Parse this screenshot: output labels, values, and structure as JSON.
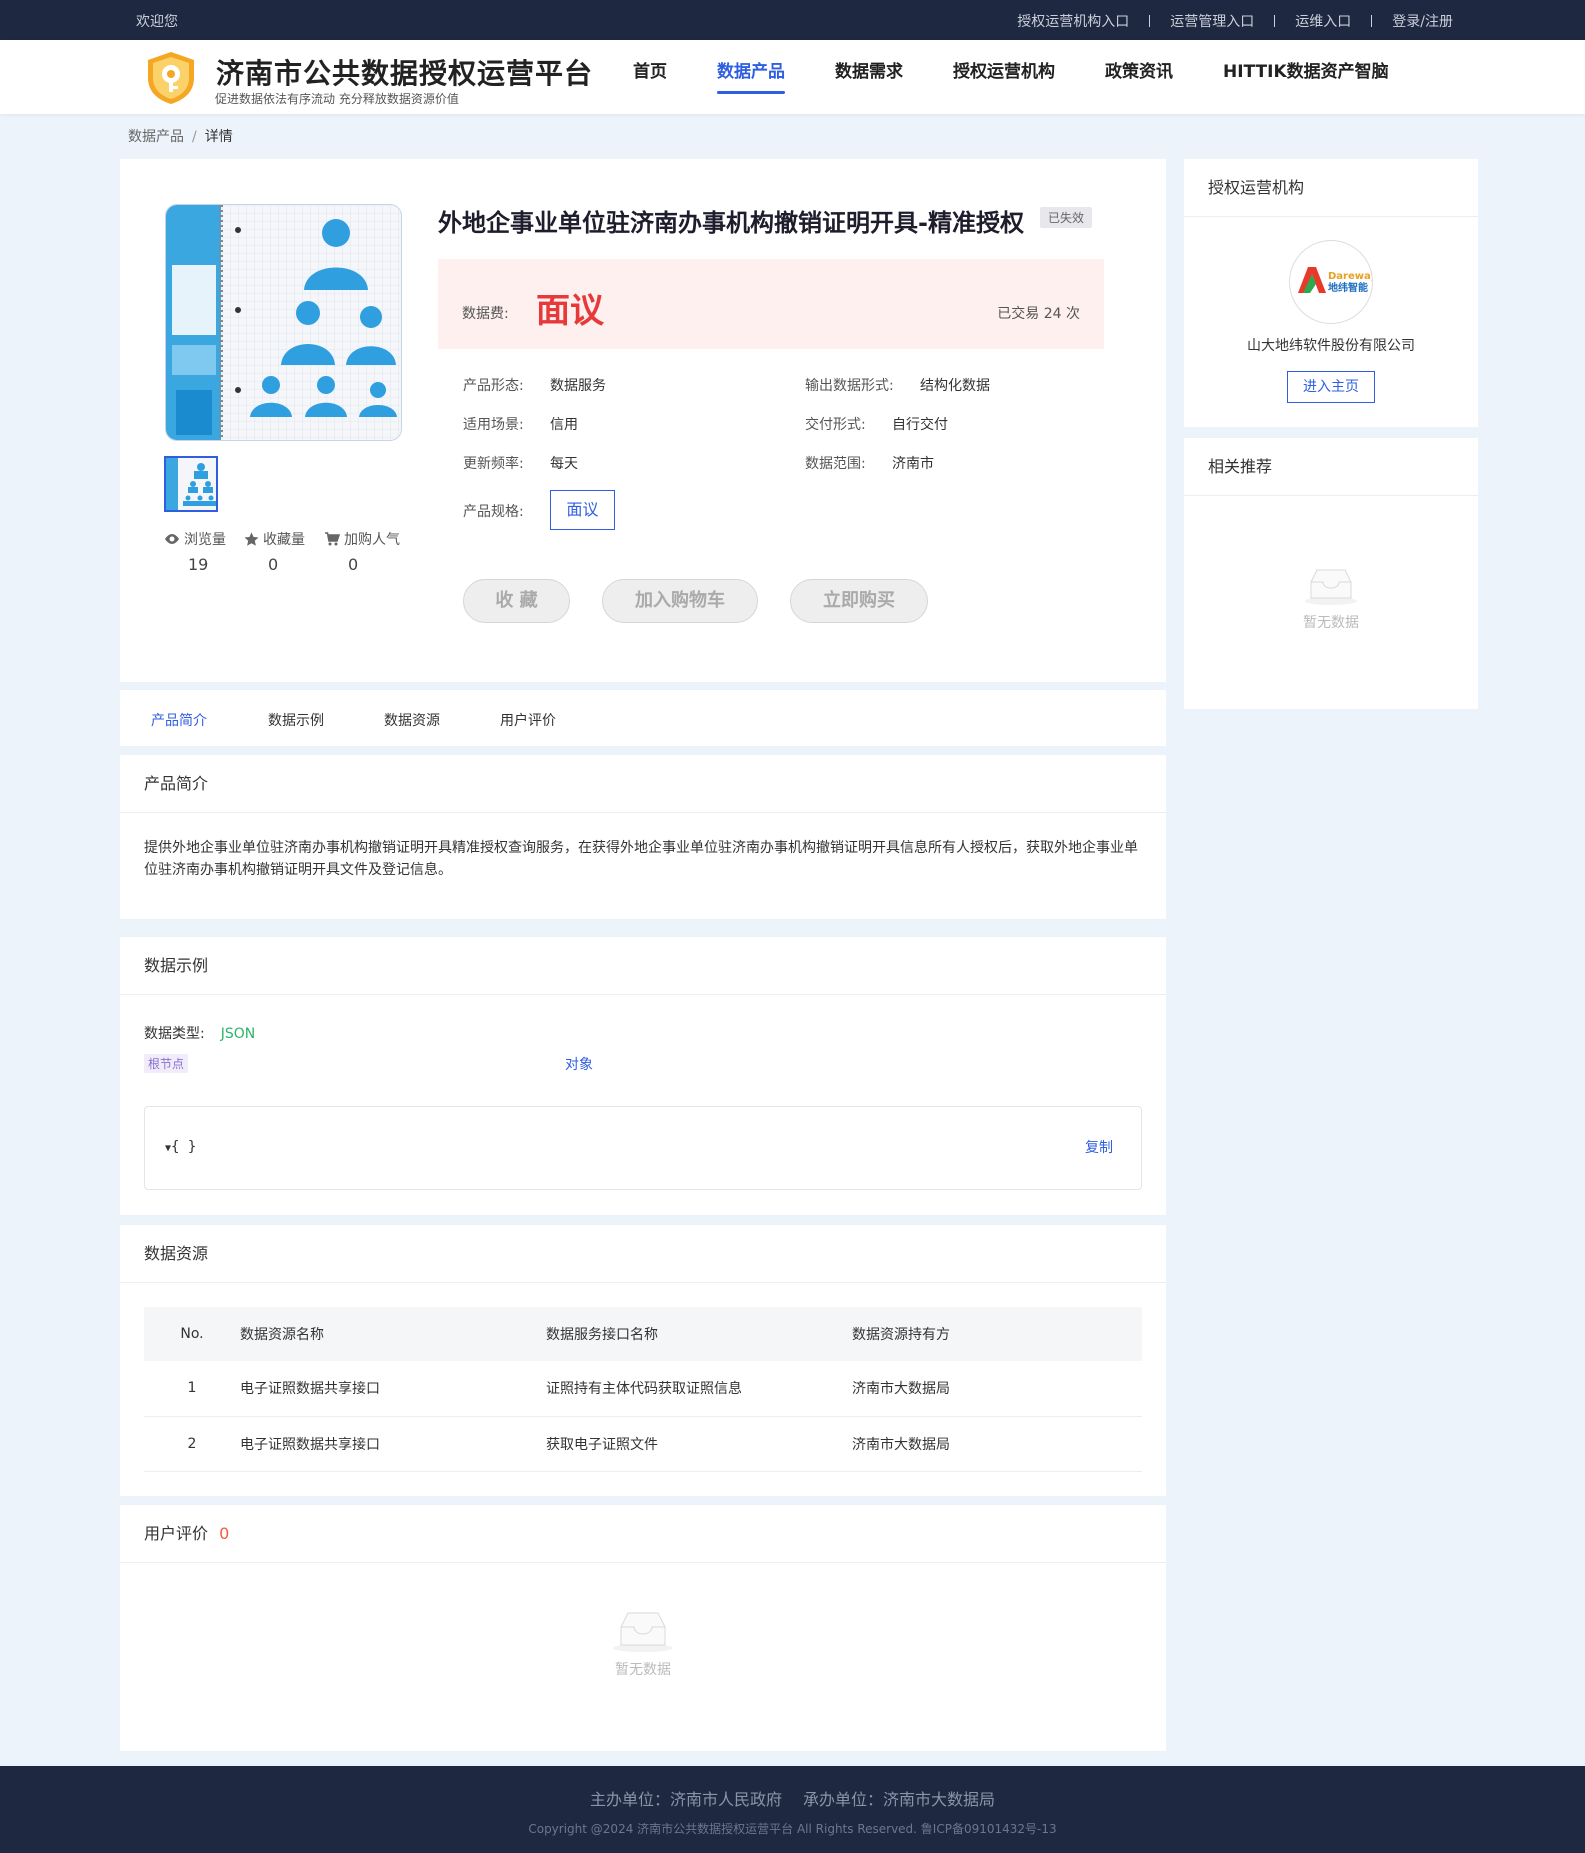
{
  "topbar": {
    "welcome": "欢迎您",
    "links": [
      "授权运营机构入口",
      "运营管理入口",
      "运维入口",
      "登录/注册"
    ]
  },
  "header": {
    "title": "济南市公共数据授权运营平台",
    "subtitle": "促进数据依法有序流动 充分释放数据资源价值",
    "nav": [
      "首页",
      "数据产品",
      "数据需求",
      "授权运营机构",
      "政策资讯",
      "HITTIK数据资产智脑"
    ],
    "active_nav": "数据产品",
    "accent_color": "#2f5fe0"
  },
  "breadcrumb": {
    "parent": "数据产品",
    "separator": "/",
    "current": "详情"
  },
  "product": {
    "title": "外地企事业单位驻济南办事机构撤销证明开具-精准授权",
    "status": "已失效",
    "price_label": "数据费:",
    "price": "面议",
    "trade_count": "已交易 24 次",
    "attributes": [
      {
        "key": "产品形态:",
        "value": "数据服务"
      },
      {
        "key": "输出数据形式:",
        "value": "结构化数据"
      },
      {
        "key": "适用场景:",
        "value": "信用"
      },
      {
        "key": "交付形式:",
        "value": "自行交付"
      },
      {
        "key": "更新频率:",
        "value": "每天"
      },
      {
        "key": "数据范围:",
        "value": "济南市"
      }
    ],
    "spec_label": "产品规格:",
    "spec_value": "面议",
    "stats": [
      {
        "label": "浏览量",
        "value": "19",
        "icon": "eye-icon"
      },
      {
        "label": "收藏量",
        "value": "0",
        "icon": "star-icon"
      },
      {
        "label": "加购人气",
        "value": "0",
        "icon": "cart-icon"
      }
    ],
    "buttons": {
      "favorite": "收 藏",
      "cart": "加入购物车",
      "buy": "立即购买"
    }
  },
  "side": {
    "org_title": "授权运营机构",
    "org_logo_text_en": "Dareway",
    "org_logo_text_cn": "地纬智能",
    "org_name": "山大地纬软件股份有限公司",
    "org_button": "进入主页",
    "recommend_title": "相关推荐",
    "empty_text": "暂无数据"
  },
  "tabs": [
    "产品简介",
    "数据示例",
    "数据资源",
    "用户评价"
  ],
  "active_tab": "产品简介",
  "intro": {
    "title": "产品简介",
    "text": "提供外地企事业单位驻济南办事机构撤销证明开具精准授权查询服务，在获得外地企事业单位驻济南办事机构撤销证明开具信息所有人授权后，获取外地企事业单位驻济南办事机构撤销证明开具文件及登记信息。"
  },
  "sample": {
    "title": "数据示例",
    "type_label": "数据类型:",
    "type_value": "JSON",
    "root_tag": "根节点",
    "object_label": "对象",
    "code": "{ }",
    "copy": "复制"
  },
  "resources": {
    "title": "数据资源",
    "columns": [
      "No.",
      "数据资源名称",
      "数据服务接口名称",
      "数据资源持有方"
    ],
    "rows": [
      [
        "1",
        "电子证照数据共享接口",
        "证照持有主体代码获取证照信息",
        "济南市大数据局"
      ],
      [
        "2",
        "电子证照数据共享接口",
        "获取电子证照文件",
        "济南市大数据局"
      ]
    ]
  },
  "reviews": {
    "title": "用户评价",
    "count": "0",
    "empty_text": "暂无数据"
  },
  "footer": {
    "line1": "主办单位：济南市人民政府　 承办单位：济南市大数据局",
    "line2": "Copyright @2024 济南市公共数据授权运营平台 All Rights Reserved. 鲁ICP备09101432号-13"
  }
}
